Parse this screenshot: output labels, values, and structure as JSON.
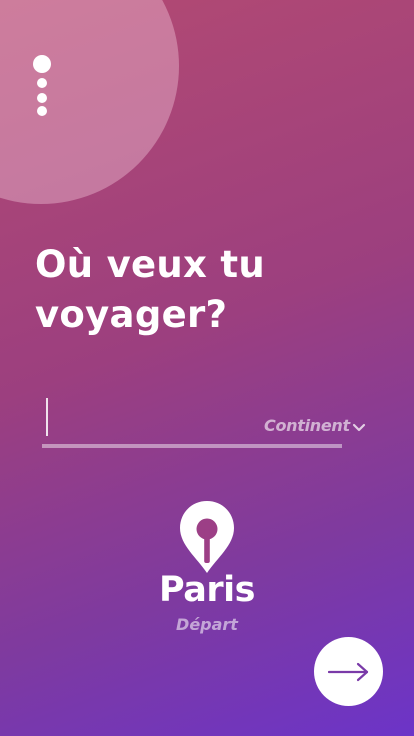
{
  "header": {
    "title_line_1": "Où veux tu",
    "title_line_2": "voyager?"
  },
  "pager": {
    "page_count": 4,
    "active_index": 0
  },
  "search": {
    "value": "",
    "placeholder": ""
  },
  "continent_filter": {
    "label": "Continent",
    "icon": "chevron-down-icon"
  },
  "departure": {
    "city": "Paris",
    "caption": "Départ",
    "icon": "map-pin-icon"
  },
  "next_button": {
    "icon": "arrow-right-icon"
  },
  "colors": {
    "gradient_start": "#b34a72",
    "gradient_end": "#6c34c8",
    "accent_arrow": "#7a3aa8",
    "text": "#ffffff"
  }
}
